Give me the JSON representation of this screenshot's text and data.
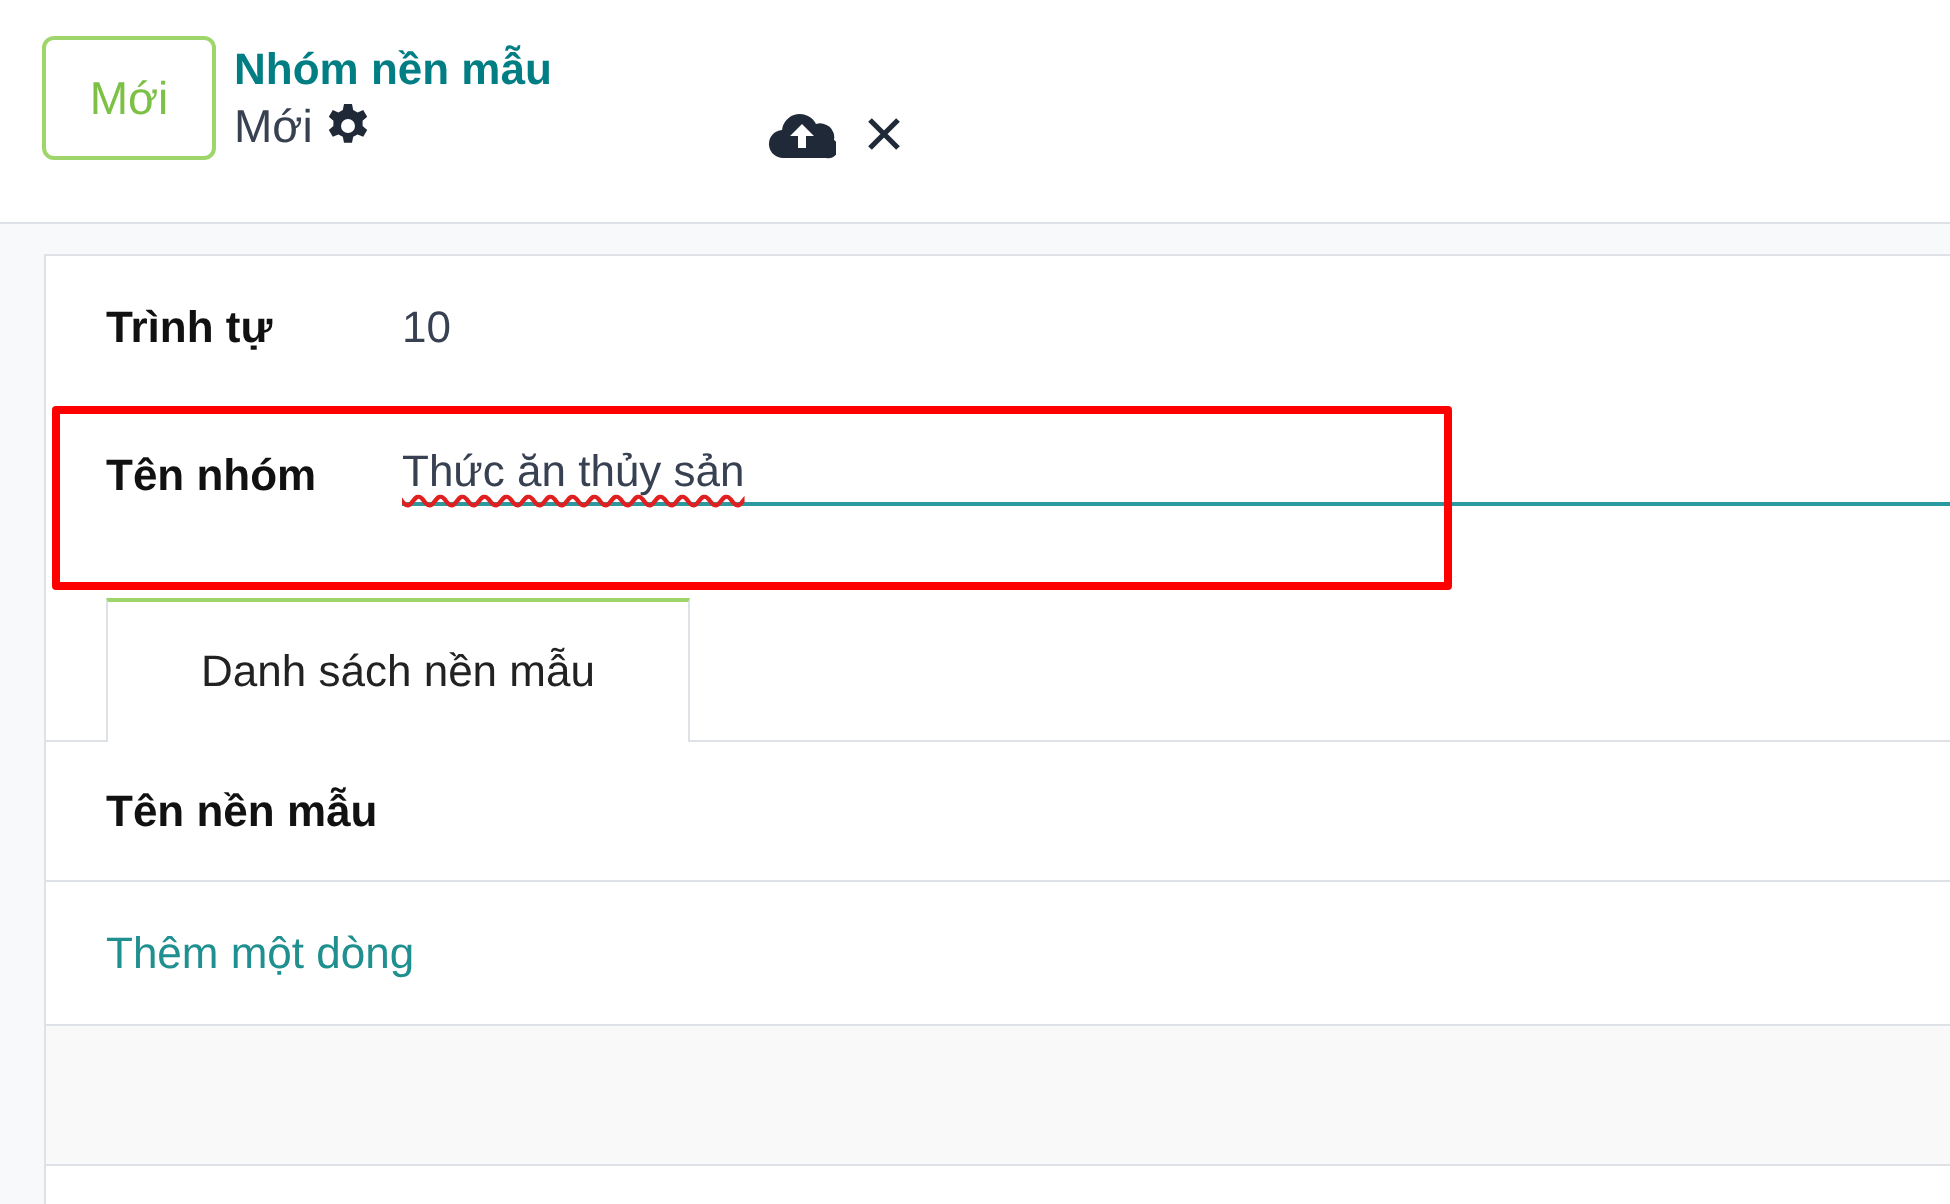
{
  "header": {
    "new_button": "Mới",
    "breadcrumb": "Nhóm nền mẫu",
    "record_title": "Mới"
  },
  "fields": [
    {
      "label": "Trình tự",
      "value": "10",
      "kind": "text"
    },
    {
      "label": "Tên nhóm",
      "value": "Thức ăn thủy sản",
      "kind": "input",
      "misspelled": true,
      "highlighted": true
    }
  ],
  "tabs": [
    {
      "label": "Danh sách nền mẫu",
      "selected": true
    }
  ],
  "table": {
    "columns": [
      "Tên nền mẫu"
    ],
    "add_line": "Thêm một dòng"
  }
}
